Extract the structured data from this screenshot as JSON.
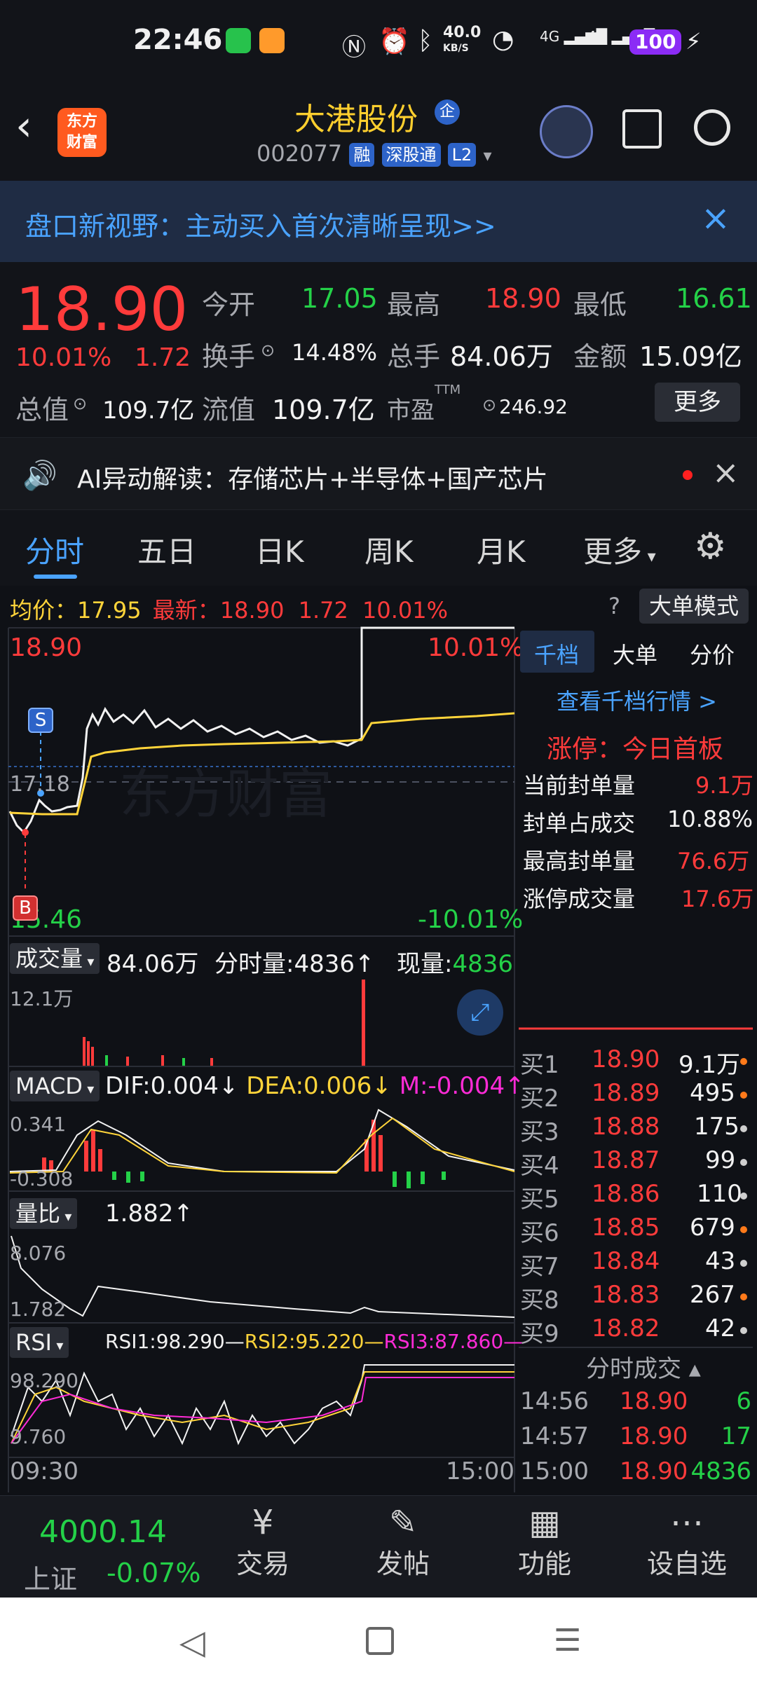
{
  "status_bar": {
    "time": "22:46",
    "net_speed_top": "40.0",
    "net_speed_bottom": "KB/S",
    "battery": "100",
    "signal_label_1": "4G",
    "signal_label_2": "4G"
  },
  "header": {
    "logo_line1": "东方",
    "logo_line2": "财富",
    "stock_name": "大港股份",
    "name_badge": "企",
    "stock_code": "002077",
    "tags": [
      "融",
      "深股通",
      "L2"
    ]
  },
  "banner": {
    "text": "盘口新视野：主动买入首次清晰呈现>>"
  },
  "quote": {
    "price": "18.90",
    "change_pct": "10.01%",
    "change_amt": "1.72",
    "open_label": "今开",
    "open": "17.05",
    "high_label": "最高",
    "high": "18.90",
    "low_label": "最低",
    "low": "16.61",
    "turnover_label": "换手",
    "turnover": "14.48%",
    "volume_label": "总手",
    "volume": "84.06万",
    "amount_label": "金额",
    "amount": "15.09亿",
    "mcap_label": "总值",
    "mcap": "109.7亿",
    "float_label": "流值",
    "float_cap": "109.7亿",
    "pe_label": "市盈",
    "pe_sup": "TTM",
    "pe": "246.92",
    "more": "更多"
  },
  "alert": {
    "text": "AI异动解读：存储芯片+半导体+国产芯片"
  },
  "tabs": {
    "items": [
      "分时",
      "五日",
      "日K",
      "周K",
      "月K",
      "更多"
    ],
    "active": 0
  },
  "chart_info": {
    "avg_label": "均价：",
    "avg": "17.95",
    "last_label": "最新：",
    "last": "18.90",
    "last_chg": "1.72",
    "last_pct": "10.01%",
    "mode_button": "大单模式",
    "price_high": "18.90",
    "price_low": "15.46",
    "price_mid": "17.18",
    "pct_high": "10.01%",
    "pct_low": "-10.01%",
    "s_marker": "S",
    "b_marker": "B",
    "watermark": "东方财富"
  },
  "volume_panel": {
    "label": "成交量",
    "total": "84.06万",
    "tick_label": "分时量:",
    "tick": "4836",
    "tick_arrow": "↑",
    "now_label": "现量:",
    "now": "4836",
    "y_max": "12.1万"
  },
  "macd_panel": {
    "label": "MACD",
    "dif_label": "DIF:",
    "dif": "0.004",
    "dif_arrow": "↓",
    "dea_label": "DEA:",
    "dea": "0.006",
    "dea_arrow": "↓",
    "m_label": "M:",
    "m": "-0.004",
    "m_arrow": "↑",
    "y_max": "0.341",
    "y_min": "-0.308"
  },
  "ratio_panel": {
    "label": "量比",
    "value": "1.882",
    "arrow": "↑",
    "y_max": "8.076",
    "y_min": "1.782"
  },
  "rsi_panel": {
    "label": "RSI",
    "rsi1": "RSI1:98.290",
    "rsi2": "RSI2:95.220",
    "rsi3": "RSI3:87.860",
    "y_max": "98.290",
    "y_min": "9.760"
  },
  "time_axis": {
    "start": "09:30",
    "end": "15:00"
  },
  "side_tabs": {
    "items": [
      "千档",
      "大单",
      "分价"
    ],
    "active": 0,
    "view_link": "查看千档行情 >"
  },
  "limit_info": {
    "title": "涨停：今日首板",
    "rows": [
      {
        "label": "当前封单量",
        "value": "9.1万"
      },
      {
        "label": "封单占成交",
        "value": "10.88%"
      },
      {
        "label": "最高封单量",
        "value": "76.6万"
      },
      {
        "label": "涨停成交量",
        "value": "17.6万"
      }
    ]
  },
  "order_book": [
    {
      "label": "买1",
      "price": "18.90",
      "vol": "9.1万"
    },
    {
      "label": "买2",
      "price": "18.89",
      "vol": "495"
    },
    {
      "label": "买3",
      "price": "18.88",
      "vol": "175"
    },
    {
      "label": "买4",
      "price": "18.87",
      "vol": "99"
    },
    {
      "label": "买5",
      "price": "18.86",
      "vol": "110"
    },
    {
      "label": "买6",
      "price": "18.85",
      "vol": "679"
    },
    {
      "label": "买7",
      "price": "18.84",
      "vol": "43"
    },
    {
      "label": "买8",
      "price": "18.83",
      "vol": "267"
    },
    {
      "label": "买9",
      "price": "18.82",
      "vol": "42"
    }
  ],
  "trades": {
    "title": "分时成交",
    "rows": [
      {
        "time": "14:56",
        "price": "18.90",
        "vol": "6"
      },
      {
        "time": "14:57",
        "price": "18.90",
        "vol": "17"
      },
      {
        "time": "15:00",
        "price": "18.90",
        "vol": "4836"
      }
    ]
  },
  "bottom_bar": {
    "index_value": "4000.14",
    "index_name": "上证",
    "index_change": "-0.07%",
    "items": [
      {
        "label": "交易"
      },
      {
        "label": "发帖"
      },
      {
        "label": "功能"
      },
      {
        "label": "设自选"
      }
    ]
  }
}
